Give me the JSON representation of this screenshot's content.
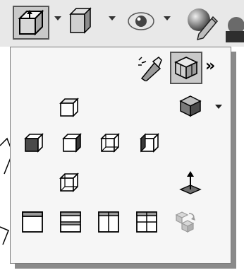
{
  "toolbar": {
    "items": [
      {
        "name": "view-orientation-button",
        "icon": "cube-arrows-icon",
        "selected": true
      },
      {
        "name": "display-style-button",
        "icon": "shaded-cube-icon"
      },
      {
        "name": "hide-show-items-button",
        "icon": "eye-icon"
      },
      {
        "name": "edit-appearance-button",
        "icon": "sphere-pencil-icon"
      }
    ]
  },
  "flyout": {
    "header": {
      "more": "»"
    },
    "standard_views": [
      "top-view",
      "isometric",
      "front",
      "right",
      "back",
      "left",
      "bottom"
    ],
    "viewport_layouts": [
      "single-view",
      "two-view-horizontal",
      "two-view-vertical",
      "four-view",
      "link-views"
    ]
  },
  "colors": {
    "panel_bg": "#f6f6f6",
    "toolbar_bg": "#e8e8e8",
    "selected_bg": "#c9c9c9",
    "border": "#555555"
  }
}
